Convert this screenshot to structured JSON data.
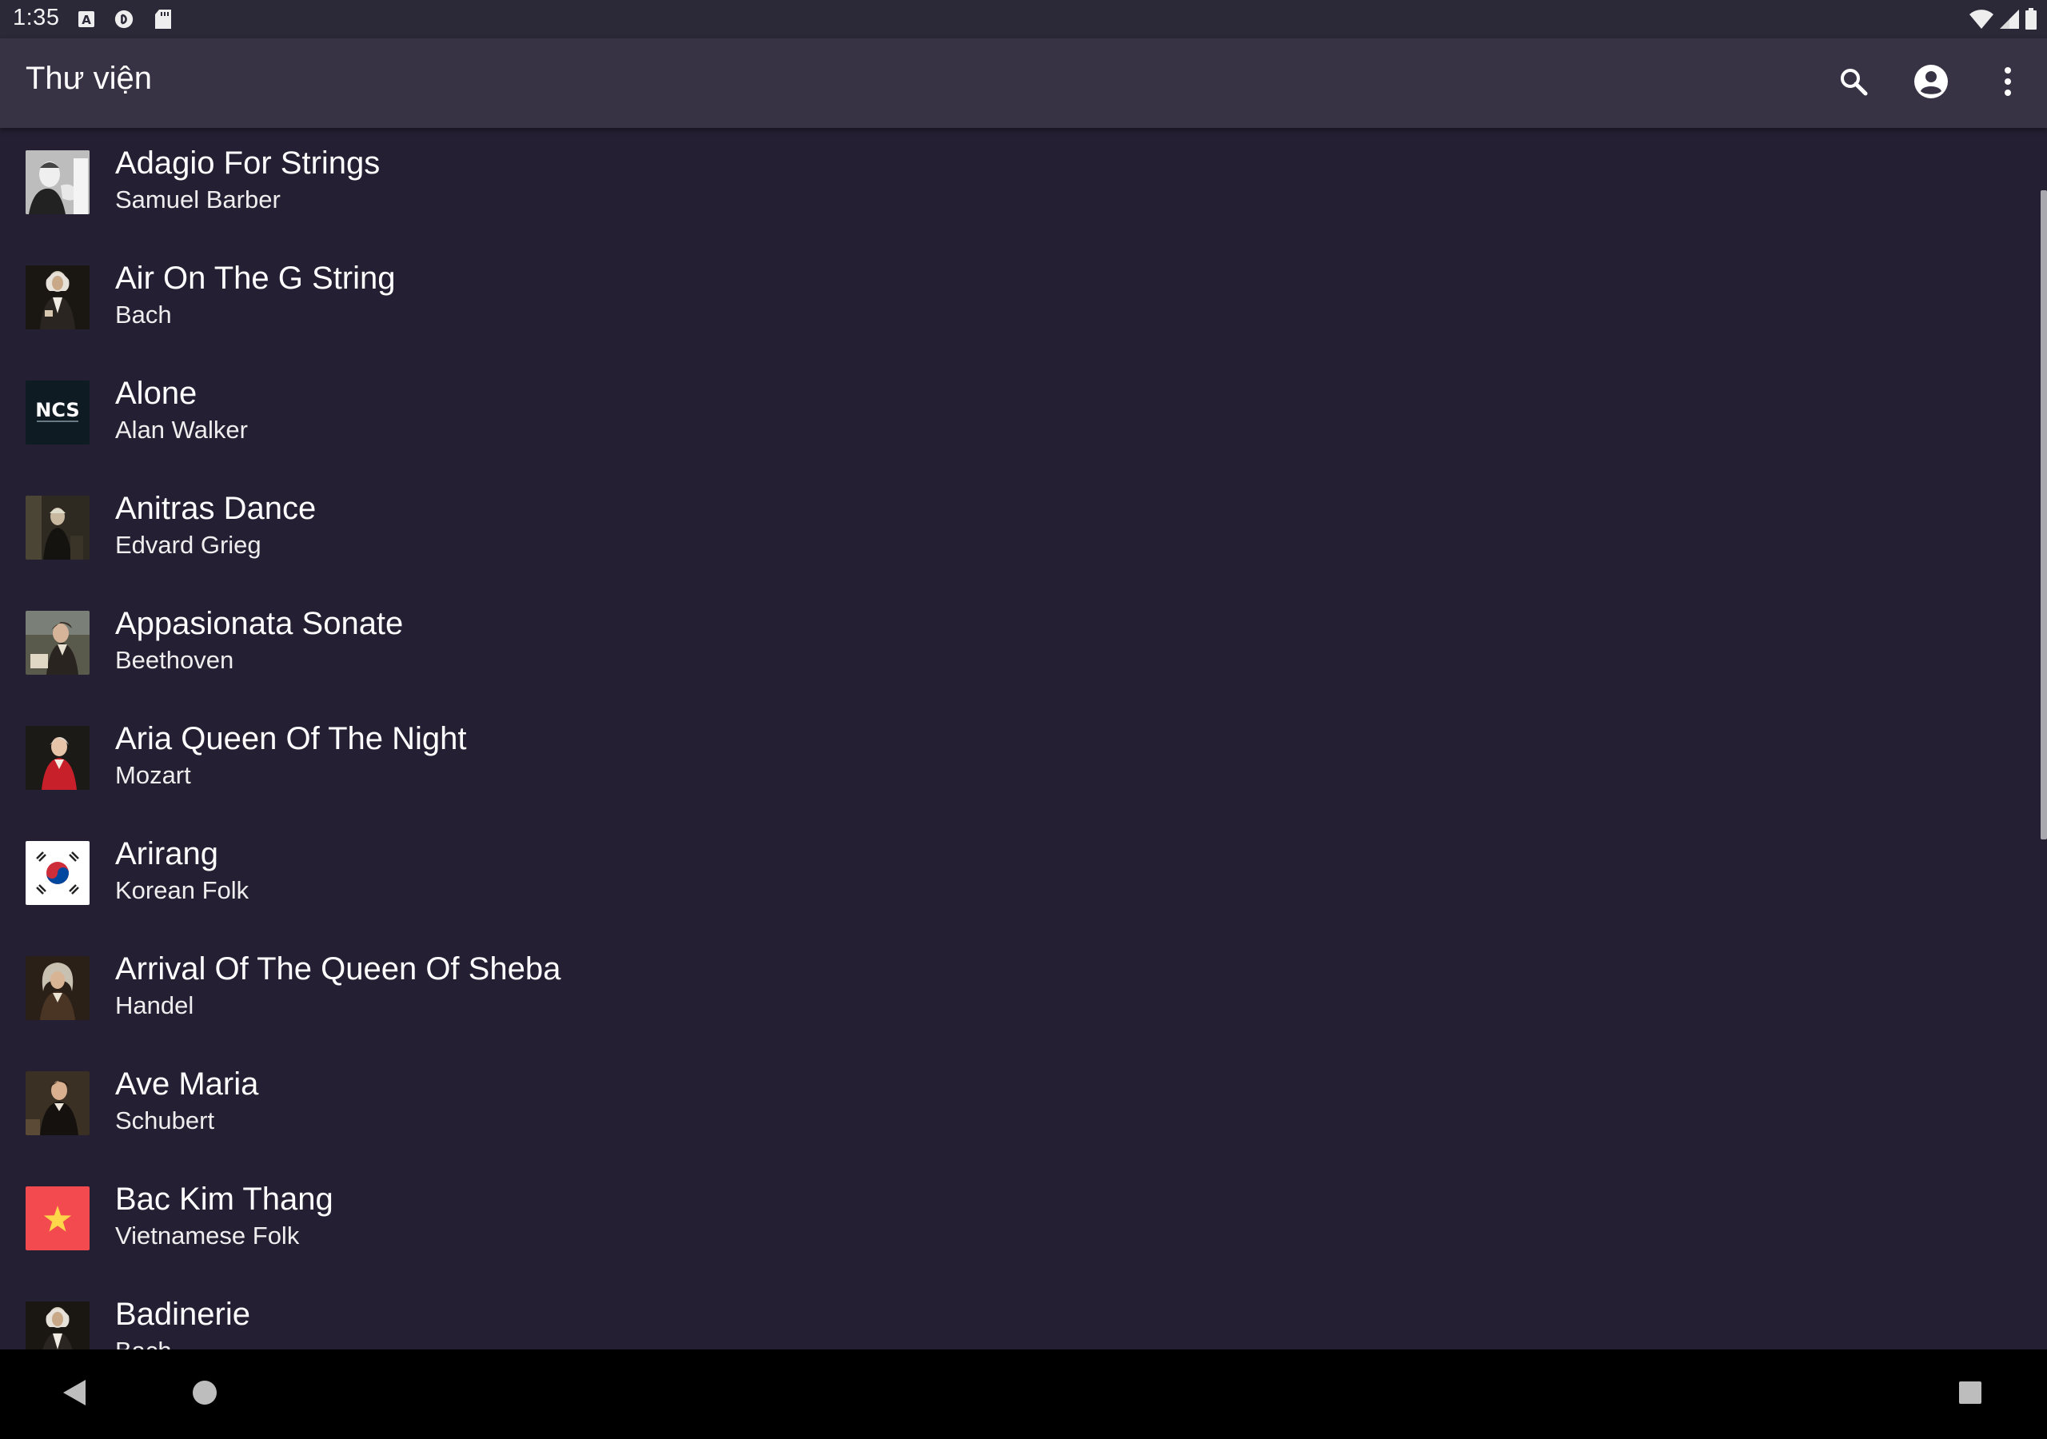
{
  "status_bar": {
    "time": "1:35",
    "left_icons": [
      "text-a-icon",
      "pocket-casts-icon",
      "sd-card-icon"
    ],
    "right_icons": [
      "wifi-icon",
      "cell-signal-icon",
      "battery-icon"
    ]
  },
  "app_bar": {
    "title": "Thư viện",
    "actions": [
      "search-icon",
      "account-circle-icon",
      "more-vert-icon"
    ]
  },
  "songs": [
    {
      "title": "Adagio For Strings",
      "artist": "Samuel Barber",
      "thumb": "portrait-bw"
    },
    {
      "title": "Air On The G String",
      "artist": "Bach",
      "thumb": "portrait-dark"
    },
    {
      "title": "Alone",
      "artist": "Alan Walker",
      "thumb": "ncs-logo",
      "thumb_text": "NCS"
    },
    {
      "title": "Anitras Dance",
      "artist": "Edvard Grieg",
      "thumb": "portrait-dark"
    },
    {
      "title": "Appasionata Sonate",
      "artist": "Beethoven",
      "thumb": "painting"
    },
    {
      "title": "Aria Queen Of The Night",
      "artist": "Mozart",
      "thumb": "portrait-red"
    },
    {
      "title": "Arirang",
      "artist": "Korean Folk",
      "thumb": "korea-flag"
    },
    {
      "title": "Arrival Of The Queen Of Sheba",
      "artist": "Handel",
      "thumb": "portrait-dark"
    },
    {
      "title": "Ave Maria",
      "artist": "Schubert",
      "thumb": "portrait-dark"
    },
    {
      "title": "Bac Kim Thang",
      "artist": "Vietnamese Folk",
      "thumb": "vietnam-flag"
    },
    {
      "title": "Badinerie",
      "artist": "Bach",
      "thumb": "portrait-dark"
    }
  ],
  "nav_bar": {
    "buttons": [
      "back-icon",
      "home-icon",
      "recents-icon"
    ]
  },
  "colors": {
    "background": "#241f32",
    "app_bar": "#373344",
    "status_bar": "#2b2838",
    "nav_bar": "#000000",
    "text": "#ffffff"
  }
}
